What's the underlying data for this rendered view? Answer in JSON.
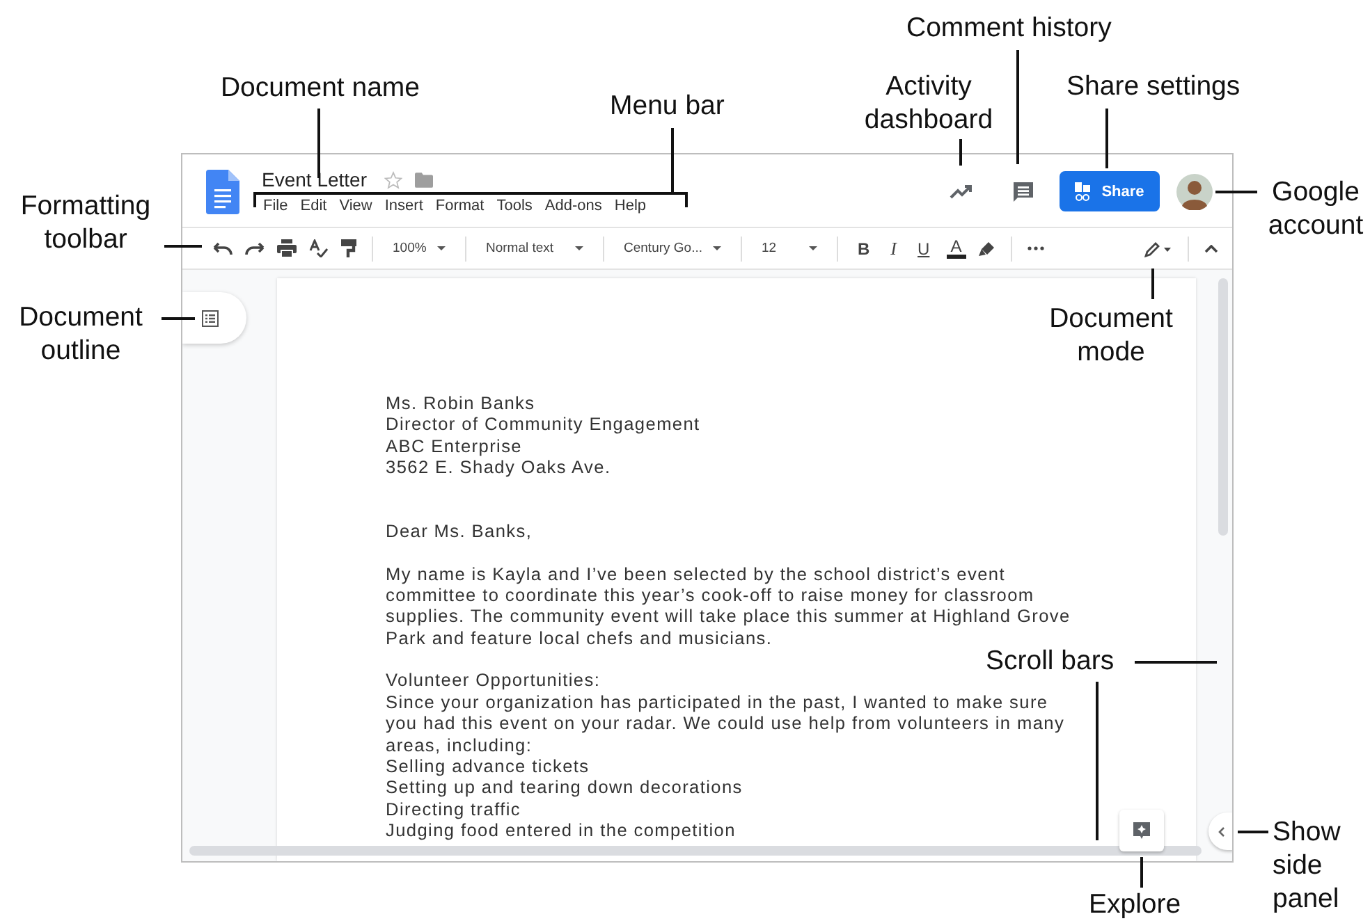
{
  "callouts": [
    "Comment history",
    "Document name",
    "Menu bar",
    "Activity dashboard",
    "Share settings",
    "Formatting toolbar",
    "Google account",
    "Document outline",
    "Document mode",
    "Scroll bars",
    "Explore",
    "Show side panel"
  ],
  "document": {
    "title": "Event Letter",
    "starred": false
  },
  "menu_bar": [
    "File",
    "Edit",
    "View",
    "Insert",
    "Format",
    "Tools",
    "Add-ons",
    "Help"
  ],
  "share_button": "Share",
  "toolbar": {
    "zoom": "100%",
    "style": "Normal text",
    "font": "Century Go...",
    "size": "12",
    "bold": "B",
    "italic": "I",
    "underline": "U",
    "text_color": "A"
  },
  "letter": {
    "recipient": [
      "Ms. Robin Banks",
      "Director of Community Engagement",
      "ABC Enterprise",
      "3562 E. Shady Oaks Ave."
    ],
    "salutation": "Dear Ms. Banks,",
    "intro": "My name is Kayla and I’ve been selected by the school district’s event committee to coordinate this year’s cook-off to raise money for classroom supplies. The community event will take place this summer at Highland Grove Park and feature local chefs and musicians.",
    "volunteer_heading": "Volunteer Opportunities:",
    "volunteer_text": "Since your organization has participated in the past, I wanted to make sure you had this event on your radar. We could use help from volunteers in many areas, including:",
    "tasks": [
      "Selling advance tickets",
      "Setting up and tearing down decorations",
      "Directing traffic",
      "Judging food entered in the competition"
    ]
  }
}
